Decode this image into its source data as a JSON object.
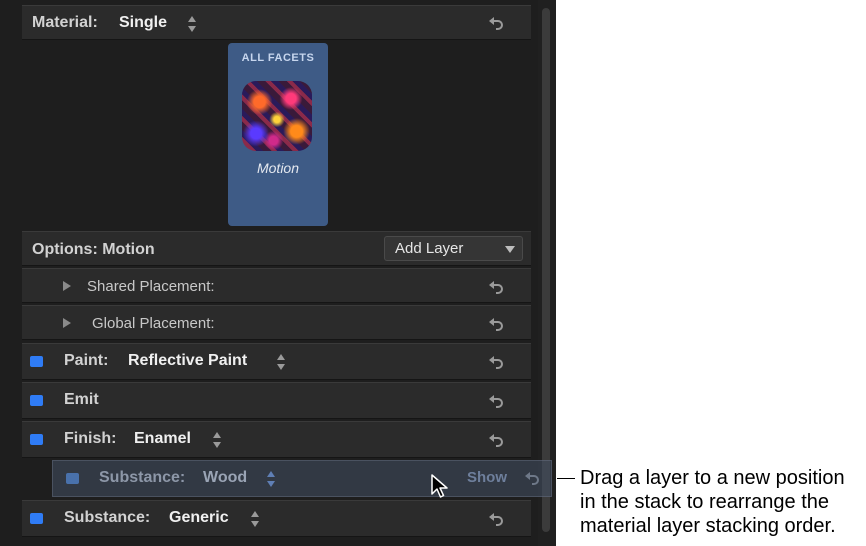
{
  "material": {
    "label": "Material:",
    "value": "Single"
  },
  "facet": {
    "title": "ALL FACETS",
    "caption": "Motion"
  },
  "options": {
    "title": "Options: Motion",
    "add_layer": "Add Layer",
    "shared_placement": "Shared Placement:",
    "global_placement": "Global Placement:"
  },
  "layers": [
    {
      "label": "Paint:",
      "value": "Reflective Paint"
    },
    {
      "label": "Emit",
      "value": ""
    },
    {
      "label": "Finish:",
      "value": "Enamel"
    },
    {
      "label": "Substance:",
      "value": "Generic"
    }
  ],
  "dragging": {
    "label": "Substance:",
    "value": "Wood",
    "show": "Show"
  },
  "callout": {
    "text": "Drag a layer to a new position\nin the stack to rearrange the\nmaterial layer stacking order."
  },
  "colors": {
    "panel_bg": "#1e1e1e",
    "row_bg": "#2b2b2b",
    "facet_card": "#3e5b86",
    "checkbox": "#2f7cf6"
  }
}
